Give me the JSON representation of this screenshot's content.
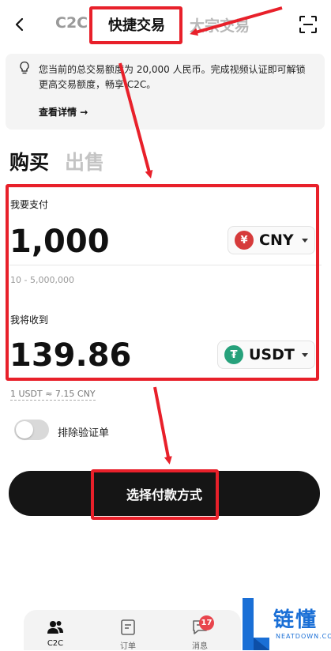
{
  "header": {
    "tabs": [
      "C2C",
      "快捷交易",
      "大宗交易"
    ]
  },
  "notice": {
    "text": "您当前的总交易额度为 20,000 人民币。完成视频认证即可解锁更高交易额度，畅享 C2C。",
    "link": "查看详情 →"
  },
  "sides": [
    "购买",
    "出售"
  ],
  "pay": {
    "label": "我要支付",
    "amount": "1,000",
    "currency": "CNY",
    "currency_symbol": "¥",
    "range": "10 - 5,000,000"
  },
  "receive": {
    "label": "我将收到",
    "amount": "139.86",
    "currency": "USDT",
    "currency_symbol": "₮"
  },
  "rate": "1 USDT ≈ 7.15 CNY",
  "toggle": {
    "label": "排除验证单",
    "on": false
  },
  "cta_label": "选择付款方式",
  "bottom_nav": {
    "items": [
      "C2C",
      "订单",
      "消息"
    ],
    "message_badge": "17"
  },
  "watermark": {
    "text": "链懂",
    "sub": "NEATDOWN.COM"
  },
  "colors": {
    "highlight": "#e8202a",
    "cta_bg": "#151515",
    "cny_coin": "#d63b3b",
    "usdt_coin": "#26a17b",
    "badge": "#e8444c",
    "watermark": "#1a6fd6"
  }
}
